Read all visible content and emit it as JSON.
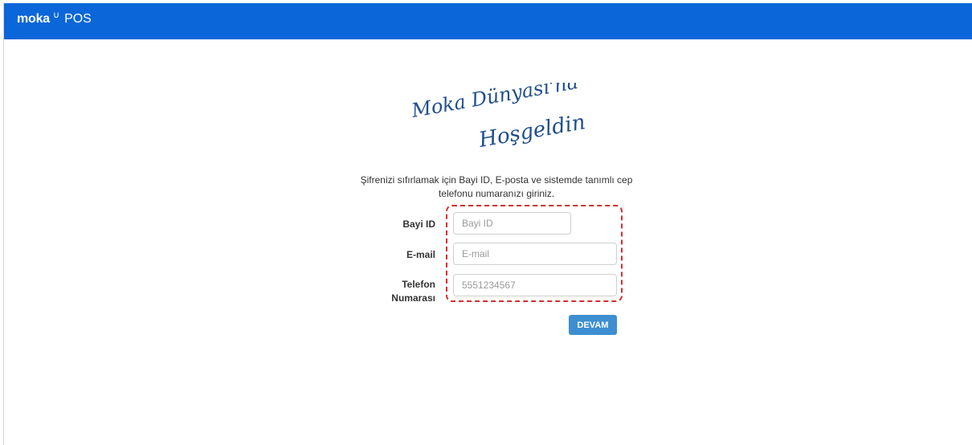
{
  "header": {
    "brand_name": "moka",
    "brand_mark": "∪",
    "product": "POS",
    "background_color": "#0A66D9"
  },
  "welcome": {
    "logo_line_1": "Moka Dünyası'na",
    "logo_line_2": "Hoşgeldin!",
    "logo_color": "#1F4E8C"
  },
  "instruction": {
    "text": "Şifrenizi sıfırlamak için Bayi ID, E-posta ve sistemde tanımlı cep telefonu numaranızı giriniz."
  },
  "form": {
    "bayi_id": {
      "label": "Bayi ID",
      "value": "",
      "placeholder": "Bayi ID"
    },
    "email": {
      "label": "E-mail",
      "value": "",
      "placeholder": "E-mail"
    },
    "phone": {
      "label_line_1": "Telefon",
      "label_line_2": "Numarası",
      "value": "",
      "placeholder": "5551234567"
    },
    "submit_label": "DEVAM",
    "submit_color": "#3D8FD1",
    "highlight_color": "#D32F2F"
  }
}
